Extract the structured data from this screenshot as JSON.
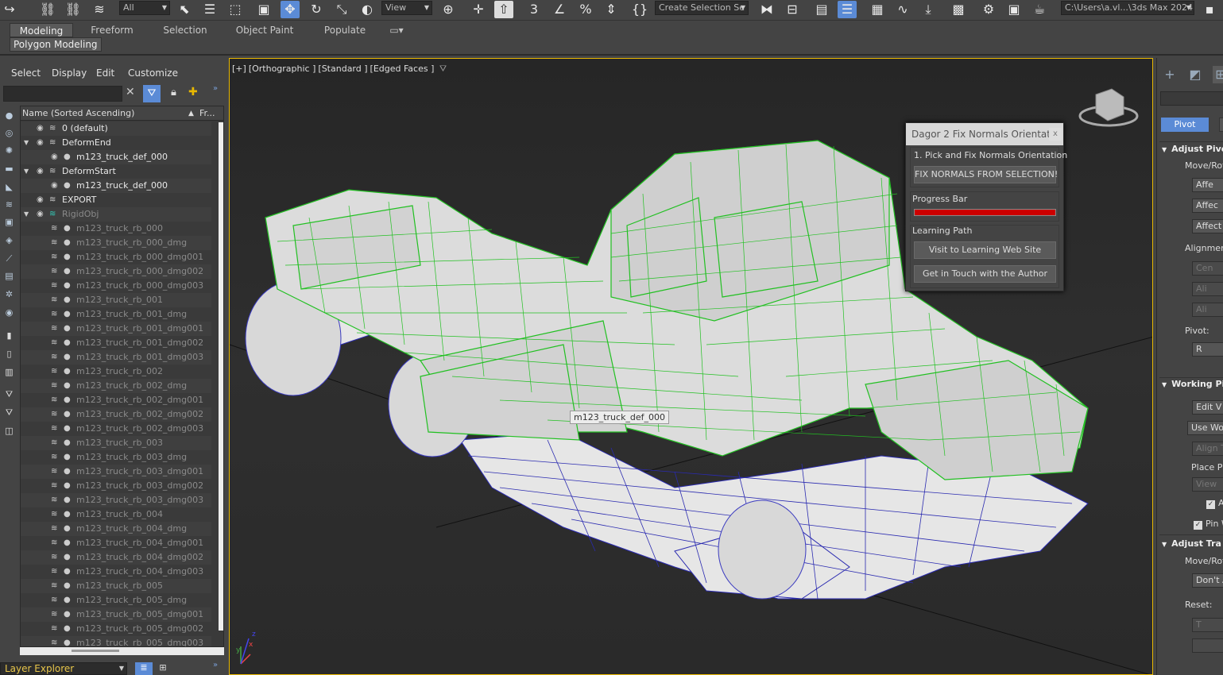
{
  "toolbar": {
    "selection_filter": "All",
    "ref_coord_system": "View",
    "named_selection": "Create Selection Se",
    "project_path": "C:\\Users\\a.vl...\\3ds Max 2024"
  },
  "ribbon": {
    "tabs": [
      "Modeling",
      "Freeform",
      "Selection",
      "Object Paint",
      "Populate"
    ],
    "active_tab": "Modeling",
    "panel_tab": "Polygon Modeling"
  },
  "explorer": {
    "menu": [
      "Select",
      "Display",
      "Edit",
      "Customize"
    ],
    "column_name": "Name (Sorted Ascending)",
    "column_frozen": "Fr...",
    "rows": [
      {
        "label": "0 (default)",
        "type": "layer",
        "level": 0
      },
      {
        "label": "DeformEnd",
        "type": "layer",
        "level": 0
      },
      {
        "label": "m123_truck_def_000",
        "type": "object",
        "level": 1
      },
      {
        "label": "DeformStart",
        "type": "layer",
        "level": 0
      },
      {
        "label": "m123_truck_def_000",
        "type": "object",
        "level": 1
      },
      {
        "label": "EXPORT",
        "type": "layer",
        "level": 0
      },
      {
        "label": "RigidObj",
        "type": "layer-hidden",
        "level": 0
      },
      {
        "label": "m123_truck_rb_000",
        "type": "hidden",
        "level": 1
      },
      {
        "label": "m123_truck_rb_000_dmg",
        "type": "hidden",
        "level": 1
      },
      {
        "label": "m123_truck_rb_000_dmg001",
        "type": "hidden",
        "level": 1
      },
      {
        "label": "m123_truck_rb_000_dmg002",
        "type": "hidden",
        "level": 1
      },
      {
        "label": "m123_truck_rb_000_dmg003",
        "type": "hidden",
        "level": 1
      },
      {
        "label": "m123_truck_rb_001",
        "type": "hidden",
        "level": 1
      },
      {
        "label": "m123_truck_rb_001_dmg",
        "type": "hidden",
        "level": 1
      },
      {
        "label": "m123_truck_rb_001_dmg001",
        "type": "hidden",
        "level": 1
      },
      {
        "label": "m123_truck_rb_001_dmg002",
        "type": "hidden",
        "level": 1
      },
      {
        "label": "m123_truck_rb_001_dmg003",
        "type": "hidden",
        "level": 1
      },
      {
        "label": "m123_truck_rb_002",
        "type": "hidden",
        "level": 1
      },
      {
        "label": "m123_truck_rb_002_dmg",
        "type": "hidden",
        "level": 1
      },
      {
        "label": "m123_truck_rb_002_dmg001",
        "type": "hidden",
        "level": 1
      },
      {
        "label": "m123_truck_rb_002_dmg002",
        "type": "hidden",
        "level": 1
      },
      {
        "label": "m123_truck_rb_002_dmg003",
        "type": "hidden",
        "level": 1
      },
      {
        "label": "m123_truck_rb_003",
        "type": "hidden",
        "level": 1
      },
      {
        "label": "m123_truck_rb_003_dmg",
        "type": "hidden",
        "level": 1
      },
      {
        "label": "m123_truck_rb_003_dmg001",
        "type": "hidden",
        "level": 1
      },
      {
        "label": "m123_truck_rb_003_dmg002",
        "type": "hidden",
        "level": 1
      },
      {
        "label": "m123_truck_rb_003_dmg003",
        "type": "hidden",
        "level": 1
      },
      {
        "label": "m123_truck_rb_004",
        "type": "hidden",
        "level": 1
      },
      {
        "label": "m123_truck_rb_004_dmg",
        "type": "hidden",
        "level": 1
      },
      {
        "label": "m123_truck_rb_004_dmg001",
        "type": "hidden",
        "level": 1
      },
      {
        "label": "m123_truck_rb_004_dmg002",
        "type": "hidden",
        "level": 1
      },
      {
        "label": "m123_truck_rb_004_dmg003",
        "type": "hidden",
        "level": 1
      },
      {
        "label": "m123_truck_rb_005",
        "type": "hidden",
        "level": 1
      },
      {
        "label": "m123_truck_rb_005_dmg",
        "type": "hidden",
        "level": 1
      },
      {
        "label": "m123_truck_rb_005_dmg001",
        "type": "hidden",
        "level": 1
      },
      {
        "label": "m123_truck_rb_005_dmg002",
        "type": "hidden",
        "level": 1
      },
      {
        "label": "m123_truck_rb_005_dmg003",
        "type": "hidden",
        "level": 1
      }
    ],
    "footer": "Layer Explorer"
  },
  "viewport": {
    "labels": [
      "[+]",
      "[Orthographic ]",
      "[Standard ]",
      "[Edged Faces ]"
    ],
    "tooltip": "m123_truck_def_000",
    "axis_x": "x",
    "axis_y": "y",
    "axis_z": "z"
  },
  "dialog": {
    "title": "Dagor 2 Fix Normals Orientati...",
    "close": "x",
    "section1": "1. Pick and Fix Normals Orientation",
    "fix_button": "FIX NORMALS FROM SELECTION!",
    "progress_label": "Progress Bar",
    "progress_value": 1.0,
    "progress_color": "#cc0000",
    "learning_label": "Learning Path",
    "learn_button": "Visit to Learning Web Site",
    "contact_button": "Get in Touch with the Author"
  },
  "command_panel": {
    "pivot_tab": "Pivot",
    "adjust_pivot": "Adjust Pivo",
    "move_rotate": "Move/Rot",
    "affect1": "Affe",
    "affect2": "Affec",
    "affect3": "Affect",
    "alignment": "Alignment",
    "center": "Cen",
    "align1": "Ali",
    "align2": "Ali",
    "pivot_label": "Pivot:",
    "reset": "R",
    "working_pivot": "Working Pi",
    "edit_wp": "Edit V",
    "use_wp": "Use Wor",
    "align_to": "Align To",
    "place_pivot": "Place Pi",
    "view": "View",
    "check_a": "A",
    "pin": "Pin W",
    "adjust_transform": "Adjust Tra",
    "move_rotate2": "Move/Rot",
    "dont": "Don't A",
    "reset_label": "Reset:",
    "t_btn": "T"
  }
}
